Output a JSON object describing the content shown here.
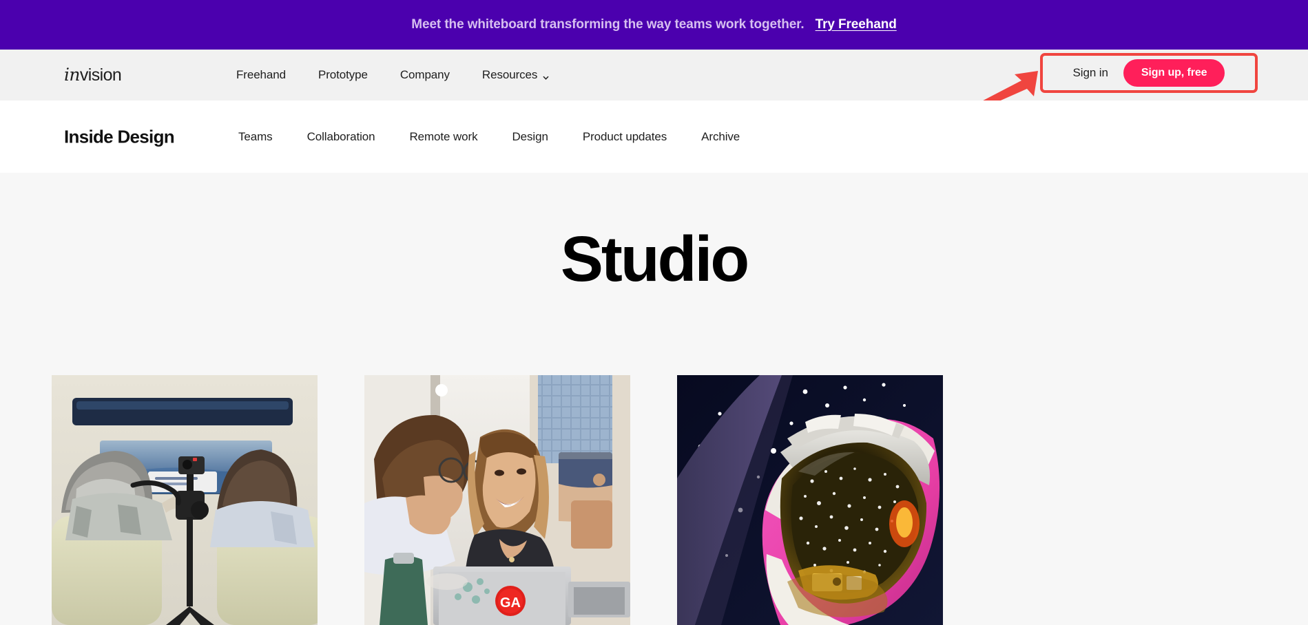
{
  "promo_banner": {
    "text": "Meet the whiteboard transforming the way teams work together.",
    "link_label": "Try Freehand",
    "background_color": "#4B00AE",
    "text_color": "#D6BFF0"
  },
  "primary_nav": {
    "logo": {
      "italic_part": "in",
      "roman_part": "vision"
    },
    "links": [
      {
        "label": "Freehand",
        "has_dropdown": false
      },
      {
        "label": "Prototype",
        "has_dropdown": false
      },
      {
        "label": "Company",
        "has_dropdown": false
      },
      {
        "label": "Resources",
        "has_dropdown": true,
        "dropdown_icon": "chevron-down-icon"
      }
    ],
    "auth": {
      "signin_label": "Sign in",
      "signup_label": "Sign up, free",
      "signup_color": "#FF1F5A"
    },
    "background_color": "#F1F1F1"
  },
  "annotations": {
    "highlight_box_color": "#F0453F",
    "arrow_color": "#F0453F",
    "arrow_icon": "arrow-pointing-up-right-icon",
    "target": "auth-buttons"
  },
  "secondary_nav": {
    "brand": "Inside Design",
    "links": [
      {
        "label": "Teams"
      },
      {
        "label": "Collaboration"
      },
      {
        "label": "Remote work"
      },
      {
        "label": "Design"
      },
      {
        "label": "Product updates"
      },
      {
        "label": "Archive"
      }
    ],
    "background_color": "#FFFFFF"
  },
  "hero": {
    "title": "Studio",
    "background_color": "#F7F7F7"
  },
  "cards": [
    {
      "image_name": "car-interior-user-research-photo",
      "alt": "Two men seated in a car interior with a camera mounted on a tripod recording a windshield display"
    },
    {
      "image_name": "office-collaboration-photo",
      "alt": "A man and a smiling woman talking at a desk with a laptop bearing a red GA sticker"
    },
    {
      "image_name": "astronaut-helmet-photo",
      "alt": "Close-up of an astronaut helmet with a gold reflective visor against a dark starry background"
    }
  ]
}
